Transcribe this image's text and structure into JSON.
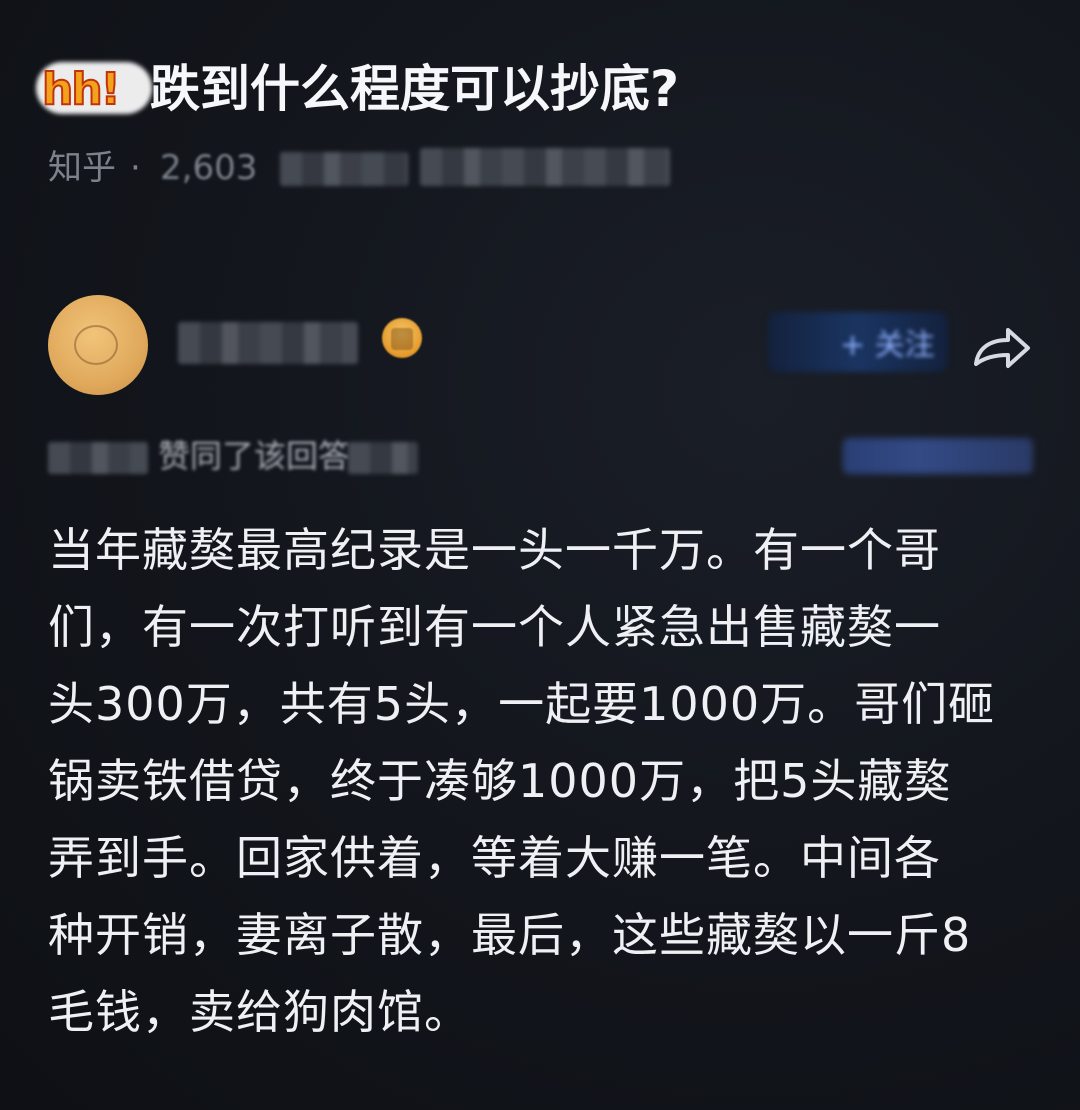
{
  "question": {
    "sticker_text": "hh!",
    "title": "跌到什么程度可以抄底?"
  },
  "meta": {
    "source": "知乎",
    "separator": "·",
    "count": "2,603"
  },
  "author": {
    "follow_label": "+ 关注",
    "share_icon": "share-arrow-icon"
  },
  "activity": {
    "liked_text": "赞同了该回答"
  },
  "answer": {
    "lines": [
      "当年藏獒最高纪录是一头一千万。有一个哥",
      "们，有一次打听到有一个人紧急出售藏獒一",
      "头300万，共有5头，一起要1000万。哥们砸",
      "锅卖铁借贷，终于凑够1000万，把5头藏獒",
      "弄到手。回家供着，等着大赚一笔。中间各",
      "种开销，妻离子散，最后，这些藏獒以一斤8",
      "毛钱，卖给狗肉馆。"
    ]
  },
  "colors": {
    "background": "#11141a",
    "title_text": "#f6f7fa",
    "body_text": "#eef0f4",
    "muted_text": "#7c818b",
    "accent_blue": "#8fb1ff",
    "sticker_orange": "#f2a21b"
  }
}
